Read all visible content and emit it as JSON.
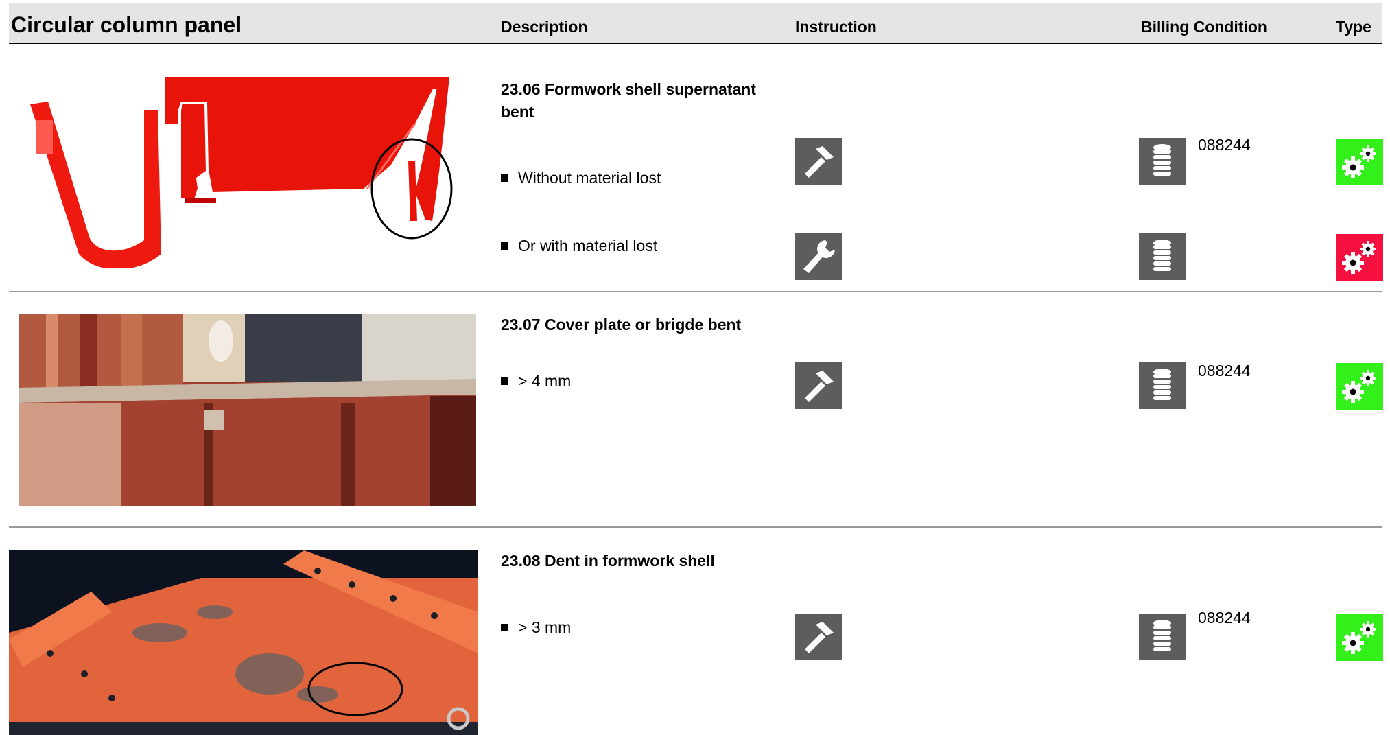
{
  "header": {
    "title": "Circular column panel",
    "columns": {
      "description": "Description",
      "instruction": "Instruction",
      "billing": "Billing Condition",
      "type": "Type"
    }
  },
  "rows": [
    {
      "title": "23.06 Formwork shell supernatant bent",
      "items": [
        {
          "text": "Without material lost",
          "instruction_icon": "hammer-icon",
          "billing_icon": "coins-icon",
          "code": "088244",
          "type_color": "#33f01a"
        },
        {
          "text": "Or with material lost",
          "instruction_icon": "wrench-icon",
          "billing_icon": "coins-icon",
          "code": "",
          "type_color": "#f5103f"
        }
      ]
    },
    {
      "title": "23.07 Cover plate or brigde bent",
      "items": [
        {
          "text": "> 4 mm",
          "instruction_icon": "hammer-icon",
          "billing_icon": "coins-icon",
          "code": "088244",
          "type_color": "#33f01a"
        }
      ]
    },
    {
      "title": "23.08 Dent in formwork shell",
      "items": [
        {
          "text": "> 3 mm",
          "instruction_icon": "hammer-icon",
          "billing_icon": "coins-icon",
          "code": "088244",
          "type_color": "#33f01a"
        }
      ]
    }
  ]
}
